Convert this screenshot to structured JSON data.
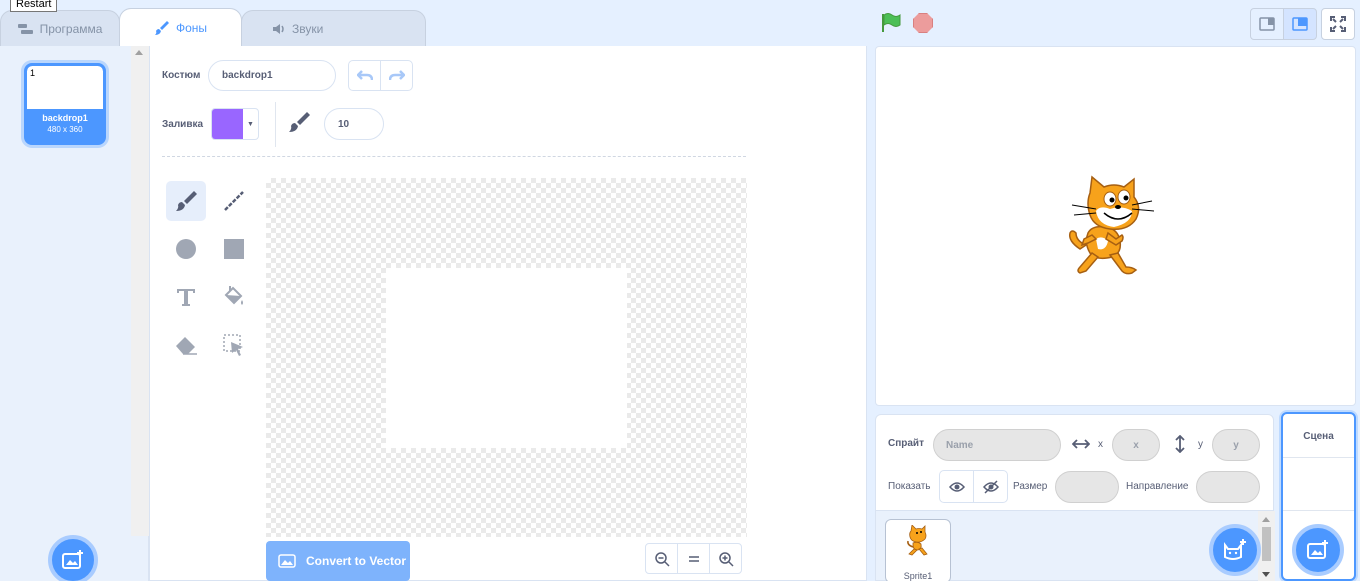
{
  "tooltip": "Restart",
  "tabs": [
    {
      "label": "Программа",
      "icon": "code-blocks-icon"
    },
    {
      "label": "Фоны",
      "icon": "brush-icon"
    },
    {
      "label": "Звуки",
      "icon": "speaker-icon"
    }
  ],
  "costumes": [
    {
      "number": "1",
      "name": "backdrop1",
      "size": "480 x 360"
    }
  ],
  "editor": {
    "costume_label": "Костюм",
    "costume_name": "backdrop1",
    "fill_label": "Заливка",
    "fill_color": "#9966ff",
    "brush_size": "10",
    "convert_button": "Convert to Vector"
  },
  "sprite_info": {
    "sprite_label": "Спрайт",
    "name_placeholder": "Name",
    "x_label": "x",
    "x_placeholder": "x",
    "y_label": "y",
    "y_placeholder": "y",
    "show_label": "Показать",
    "size_label": "Размер",
    "direction_label": "Направление"
  },
  "sprites": [
    {
      "name": "Sprite1"
    }
  ],
  "scene": {
    "title": "Сцена"
  },
  "colors": {
    "accent": "#4c97ff",
    "flag": "#4cbf56",
    "stop": "#ec9c9c",
    "cat_orange": "#f7a21b"
  }
}
